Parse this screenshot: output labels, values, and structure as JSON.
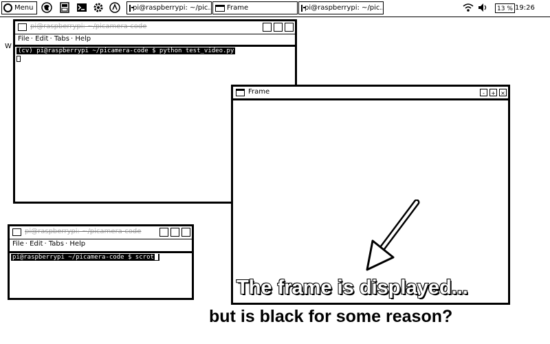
{
  "taskbar": {
    "menu_label": "Menu",
    "tasks": [
      {
        "label": "pi@raspberrypi: ~/pic..."
      },
      {
        "label": "Frame"
      },
      {
        "label": "pi@raspberrypi: ~/pic..."
      }
    ],
    "battery": "13 %",
    "clock": "19:26"
  },
  "terminal_top": {
    "title": "pi@raspberrypi: ~/picamera-code",
    "menu": [
      "File",
      "Edit",
      "Tabs",
      "Help"
    ],
    "prompt": "(cv) pi@raspberrypi ~/picamera-code $ python test_video.py",
    "stray_char": "W"
  },
  "terminal_bottom": {
    "title": "pi@raspberrypi: ~/picamera-code",
    "menu": [
      "File",
      "Edit",
      "Tabs",
      "Help"
    ],
    "prompt": "pi@raspberrypi ~/picamera-code $ scrot"
  },
  "frame_window": {
    "title": "Frame"
  },
  "caption": {
    "line1": "The frame is displayed...",
    "line2": "but is black for some reason?"
  }
}
